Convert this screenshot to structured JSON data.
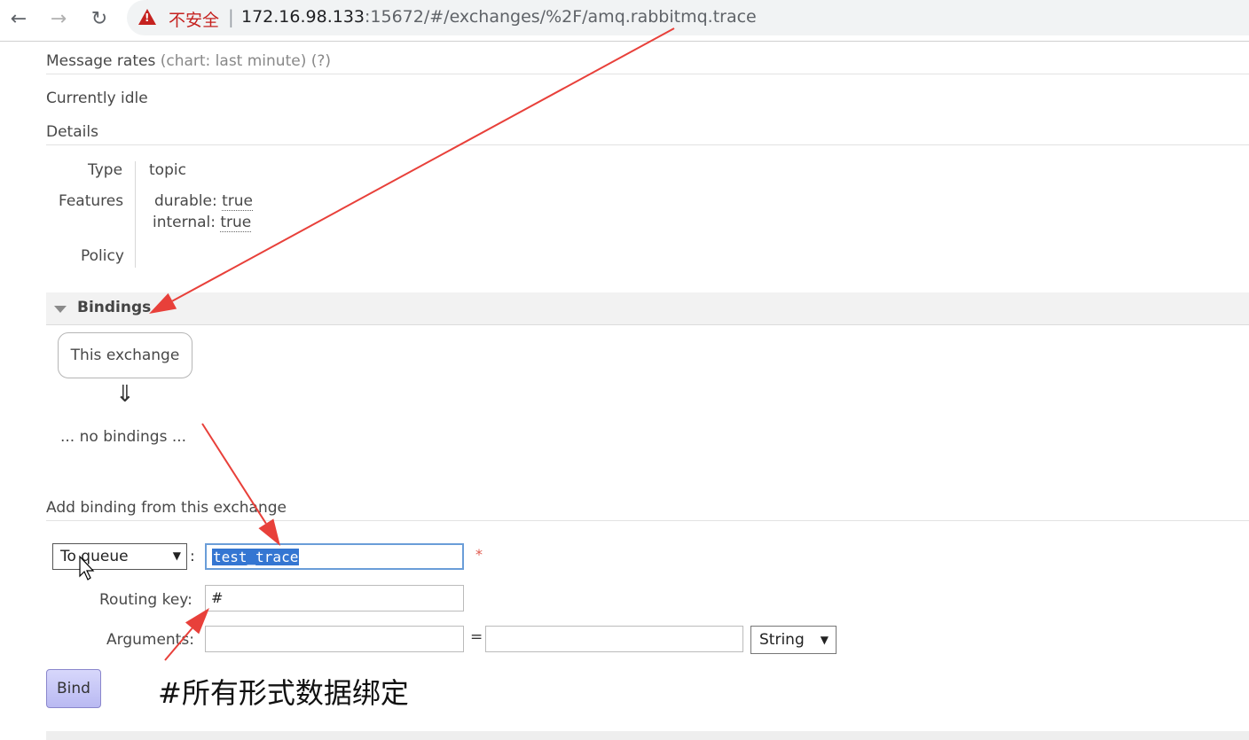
{
  "browser": {
    "back_icon": "←",
    "forward_icon": "→",
    "reload_icon": "↻",
    "security_label": "不安全",
    "separator": "|",
    "url_host": "172.16.98.133",
    "url_rest": ":15672/#/exchanges/%2F/amq.rabbitmq.trace"
  },
  "message_rates": {
    "label": "Message rates",
    "chart_note": "(chart: last minute)",
    "help": "(?)",
    "status": "Currently idle"
  },
  "details": {
    "title": "Details",
    "type_label": "Type",
    "type_value": "topic",
    "features_label": "Features",
    "durable_label": "durable:",
    "durable_value": "true",
    "internal_label": "internal:",
    "internal_value": "true",
    "policy_label": "Policy"
  },
  "bindings": {
    "title": "Bindings",
    "exchange_box": "This exchange",
    "arrow": "⇓",
    "empty": "... no bindings ..."
  },
  "add_binding": {
    "title": "Add binding from this exchange",
    "destination_type": "To queue",
    "colon": ":",
    "destination_value": "test_trace",
    "required_mark": "*",
    "routing_key_label": "Routing key:",
    "routing_key_value": "#",
    "arguments_label": "Arguments:",
    "arguments_key": "",
    "equals": "=",
    "arguments_value": "",
    "argument_type": "String",
    "bind_button": "Bind"
  },
  "annotation": {
    "text": "#所有形式数据绑定",
    "arrow_color": "#e8403a"
  }
}
